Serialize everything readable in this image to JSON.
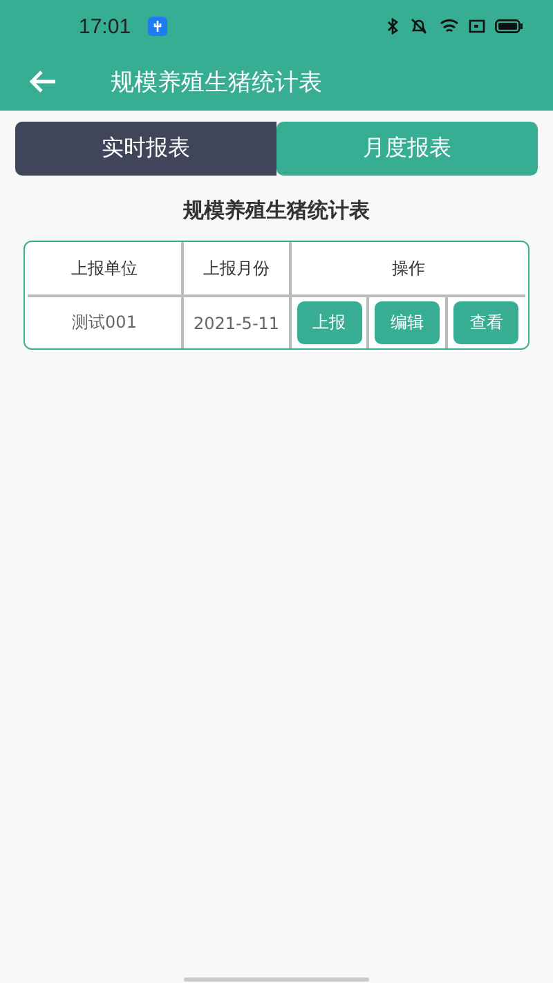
{
  "status_bar": {
    "time": "17:01"
  },
  "toolbar": {
    "title": "规模养殖生猪统计表"
  },
  "tabs": [
    {
      "label": "实时报表",
      "selected": false
    },
    {
      "label": "月度报表",
      "selected": true
    }
  ],
  "report_title": "规模养殖生猪统计表",
  "table": {
    "columns": [
      "上报单位",
      "上报月份",
      "操作"
    ],
    "rows": [
      {
        "unit": "测试001",
        "month": "2021-5-11",
        "actions": [
          "上报",
          "编辑",
          "查看"
        ]
      }
    ]
  }
}
